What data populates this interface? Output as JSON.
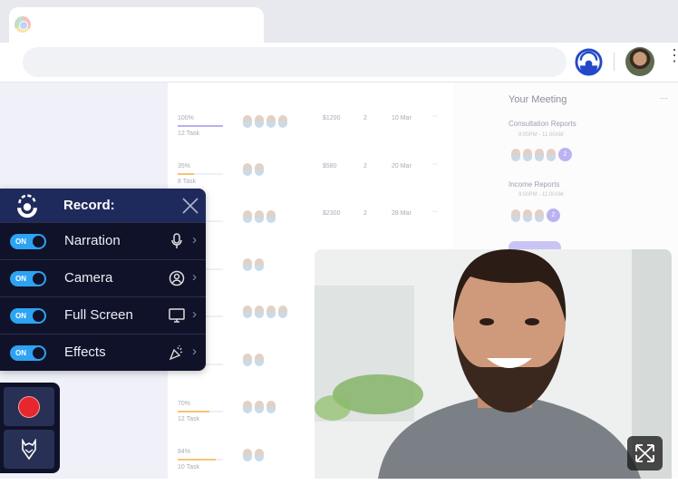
{
  "browser": {
    "address": "",
    "extension_icon": "recorder-logo-icon",
    "profile_icon": "avatar",
    "menu_icon": "kebab-menu-icon"
  },
  "dashboard": {
    "rows": [
      {
        "percent": "100%",
        "tasks": "12 Task",
        "amount": "$1200",
        "count": "2",
        "date": "10 Mar",
        "faces": 4,
        "progress": 100,
        "color": "#b7b1ee"
      },
      {
        "percent": "35%",
        "tasks": "8 Task",
        "amount": "$580",
        "count": "2",
        "date": "20 Mar",
        "faces": 2,
        "progress": 35,
        "color": "#f6c27a"
      },
      {
        "percent": "",
        "tasks": "",
        "amount": "$2300",
        "count": "2",
        "date": "28 Mar",
        "faces": 3,
        "progress": 0,
        "color": "#b7b1ee"
      },
      {
        "percent": "",
        "tasks": "",
        "amount": "",
        "count": "",
        "date": "",
        "faces": 2,
        "progress": 0,
        "color": "#b7b1ee"
      },
      {
        "percent": "",
        "tasks": "",
        "amount": "",
        "count": "",
        "date": "",
        "faces": 4,
        "progress": 0,
        "color": "#b7b1ee"
      },
      {
        "percent": "",
        "tasks": "",
        "amount": "",
        "count": "",
        "date": "",
        "faces": 2,
        "progress": 0,
        "color": "#b7b1ee"
      },
      {
        "percent": "70%",
        "tasks": "12 Task",
        "amount": "",
        "count": "",
        "date": "",
        "faces": 3,
        "progress": 70,
        "color": "#f6c27a"
      },
      {
        "percent": "84%",
        "tasks": "10 Task",
        "amount": "",
        "count": "",
        "date": "",
        "faces": 2,
        "progress": 84,
        "color": "#f6c27a"
      }
    ],
    "meeting": {
      "title": "Your Meeting",
      "items": [
        {
          "name": "Consultation Reports",
          "time": "9:00PM - 11:00AM",
          "extra": "2"
        },
        {
          "name": "Income Reports",
          "time": "9:00PM - 11:00AM",
          "extra": "2"
        }
      ]
    }
  },
  "record": {
    "title": "Record:",
    "close_icon": "close-icon",
    "options": [
      {
        "label": "Narration",
        "toggle": "ON",
        "icon": "microphone-icon"
      },
      {
        "label": "Camera",
        "toggle": "ON",
        "icon": "user-circle-icon"
      },
      {
        "label": "Full Screen",
        "toggle": "ON",
        "icon": "monitor-icon"
      },
      {
        "label": "Effects",
        "toggle": "ON",
        "icon": "party-popper-icon"
      }
    ],
    "record_button_color": "#e8262e"
  },
  "webcam": {
    "expand_icon": "expand-icon"
  }
}
